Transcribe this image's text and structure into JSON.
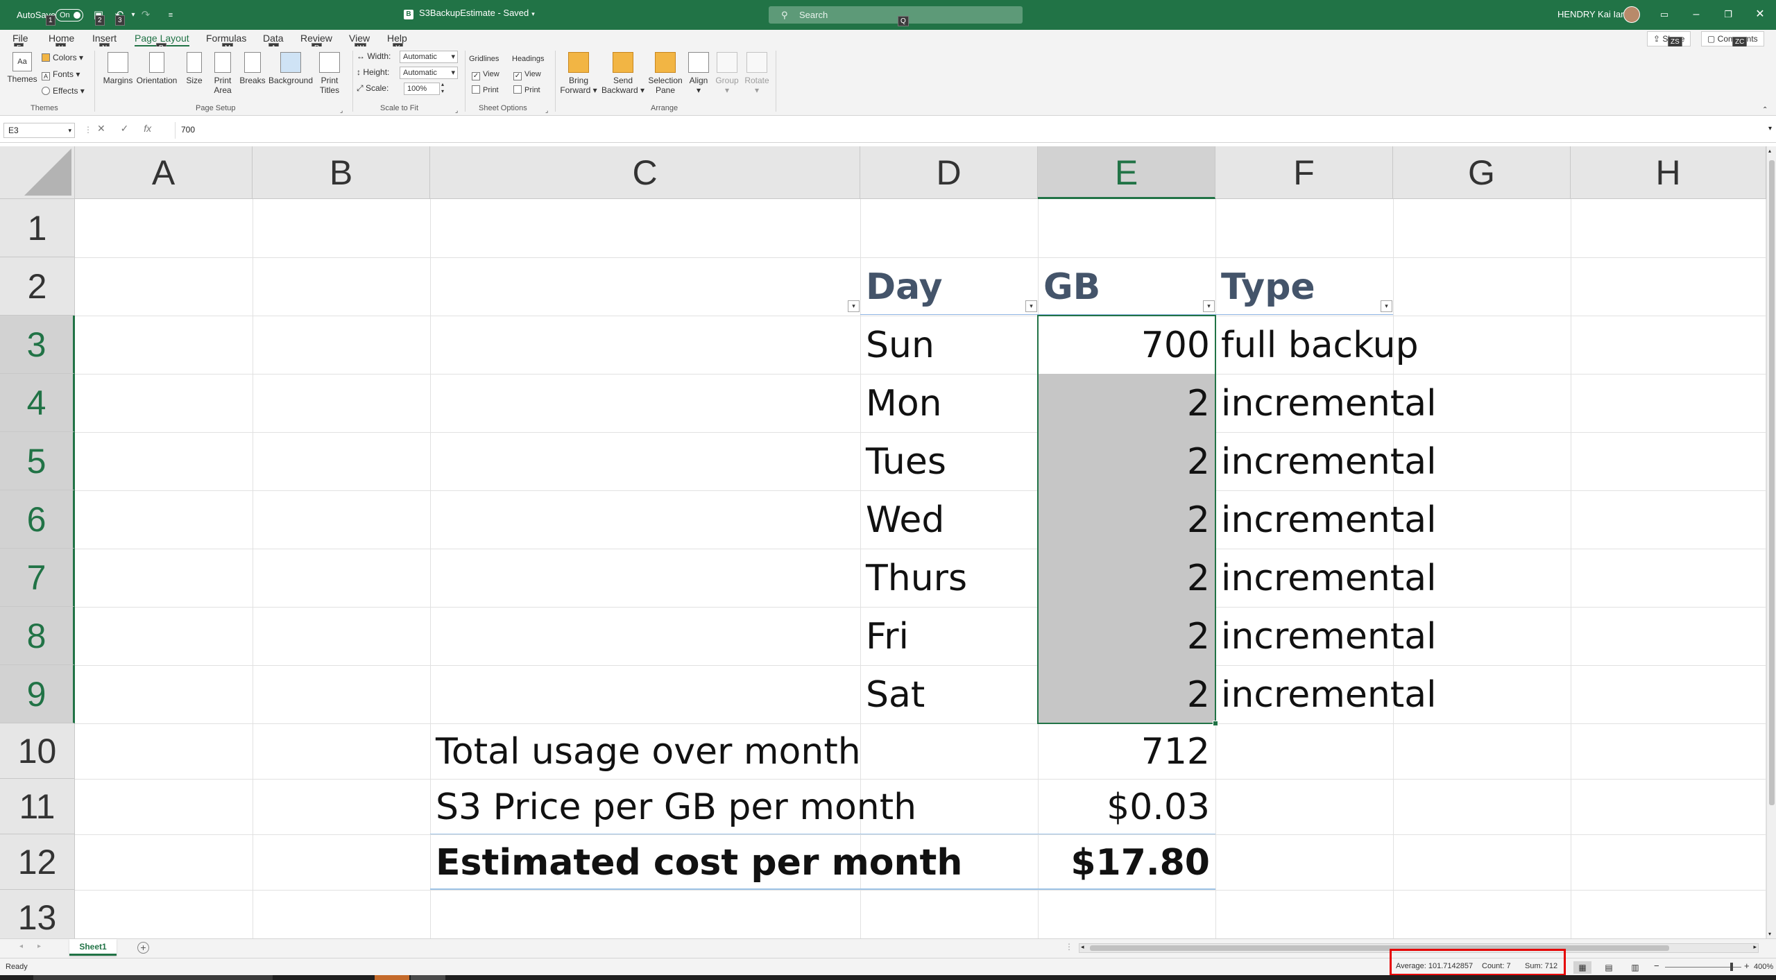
{
  "titlebar": {
    "autosave_label": "AutoSave",
    "autosave_state": "On",
    "file_name": "S3BackupEstimate",
    "save_state": "Saved",
    "file_icon_letter": "B",
    "search_placeholder": "Search",
    "search_keytip": "Q",
    "user_name": "HENDRY Kai Ian",
    "qat_keytips": [
      "1",
      "2",
      "3"
    ]
  },
  "ribbon_tabs": [
    {
      "label": "File",
      "keytip": "F"
    },
    {
      "label": "Home",
      "keytip": "H"
    },
    {
      "label": "Insert",
      "keytip": "N"
    },
    {
      "label": "Page Layout",
      "keytip": "P",
      "active": true
    },
    {
      "label": "Formulas",
      "keytip": "M"
    },
    {
      "label": "Data",
      "keytip": "A"
    },
    {
      "label": "Review",
      "keytip": "R"
    },
    {
      "label": "View",
      "keytip": "W"
    },
    {
      "label": "Help",
      "keytip": "Y"
    }
  ],
  "share": {
    "label": "Share",
    "keytip": "ZS"
  },
  "comments": {
    "label": "Comments",
    "keytip": "ZC"
  },
  "ribbon": {
    "themes": {
      "themes": "Themes",
      "colors": "Colors",
      "fonts": "Fonts",
      "effects": "Effects",
      "group": "Themes"
    },
    "page_setup": {
      "margins": "Margins",
      "orientation": "Orientation",
      "size": "Size",
      "print_area_1": "Print",
      "print_area_2": "Area",
      "breaks": "Breaks",
      "background": "Background",
      "print_titles_1": "Print",
      "print_titles_2": "Titles",
      "group": "Page Setup"
    },
    "scale": {
      "width_label": "Width:",
      "width_value": "Automatic",
      "height_label": "Height:",
      "height_value": "Automatic",
      "scale_label": "Scale:",
      "scale_value": "100%",
      "group": "Scale to Fit"
    },
    "sheet_options": {
      "gridlines": "Gridlines",
      "headings": "Headings",
      "view": "View",
      "print": "Print",
      "group": "Sheet Options"
    },
    "arrange": {
      "bring_1": "Bring",
      "bring_2": "Forward",
      "send_1": "Send",
      "send_2": "Backward",
      "selection_1": "Selection",
      "selection_2": "Pane",
      "align": "Align",
      "group_btn": "Group",
      "rotate": "Rotate",
      "group": "Arrange"
    }
  },
  "formula_bar": {
    "name_box": "E3",
    "fx": "fx",
    "value": "700"
  },
  "columns": [
    "A",
    "B",
    "C",
    "D",
    "E",
    "F",
    "G",
    "H"
  ],
  "rows": [
    "1",
    "2",
    "3",
    "4",
    "5",
    "6",
    "7",
    "8",
    "9",
    "10",
    "11",
    "12",
    "13"
  ],
  "table": {
    "headers": {
      "day": "Day",
      "gb": "GB",
      "type": "Type"
    },
    "rows": [
      {
        "day": "Sun",
        "gb": "700",
        "type": "full backup"
      },
      {
        "day": "Mon",
        "gb": "2",
        "type": "incremental"
      },
      {
        "day": "Tues",
        "gb": "2",
        "type": "incremental"
      },
      {
        "day": "Wed",
        "gb": "2",
        "type": "incremental"
      },
      {
        "day": "Thurs",
        "gb": "2",
        "type": "incremental"
      },
      {
        "day": "Fri",
        "gb": "2",
        "type": "incremental"
      },
      {
        "day": "Sat",
        "gb": "2",
        "type": "incremental"
      }
    ]
  },
  "summary": {
    "total_label": "Total usage over month",
    "total_value": "712",
    "price_label": "S3 Price per GB per month",
    "price_value": "$0.03",
    "cost_label": "Estimated cost per month",
    "cost_value": "$17.80"
  },
  "sheet_tabs": {
    "active": "Sheet1"
  },
  "statusbar": {
    "ready": "Ready",
    "average": "Average: 101.7142857",
    "count": "Count: 7",
    "sum": "Sum: 712",
    "zoom": "400%"
  },
  "colors": {
    "accent": "#217346",
    "highlight": "#e60000",
    "table_header": "#44546a"
  }
}
